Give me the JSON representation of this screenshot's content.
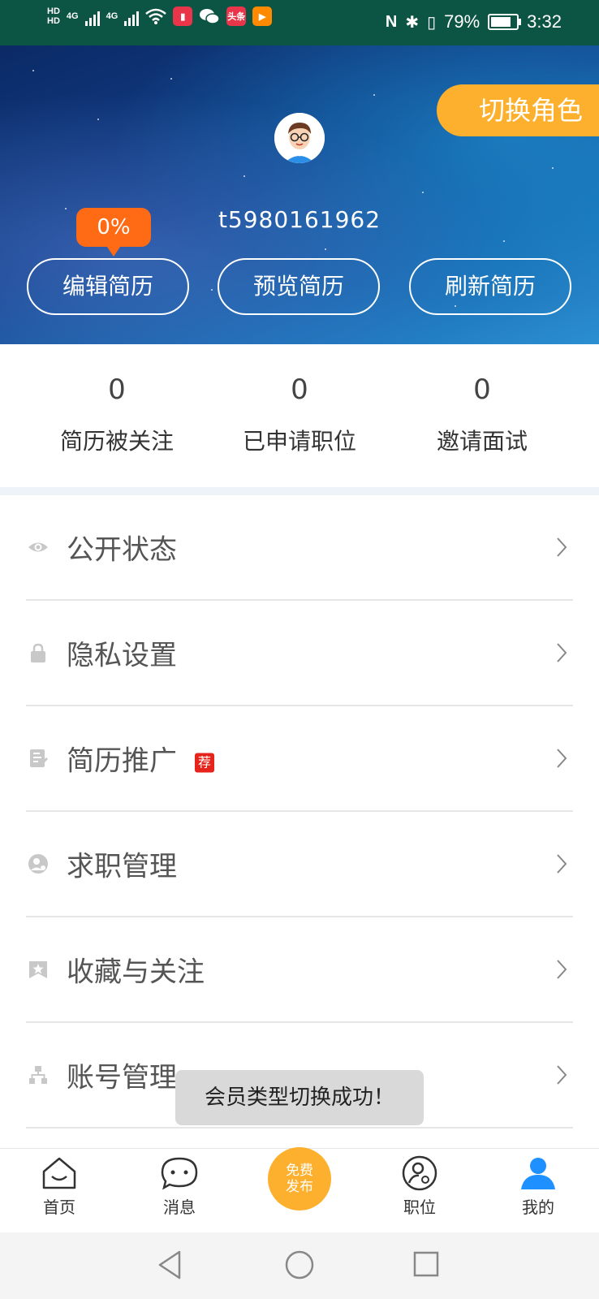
{
  "status_bar": {
    "left_label_1": "HD",
    "left_label_2": "HD",
    "signal_1": "4G",
    "signal_2": "4G",
    "app_toutiao": "头条",
    "battery": "79%",
    "time": "3:32"
  },
  "header": {
    "switch_role": "切换角色",
    "username": "t5980161962",
    "resume_completion": "0%",
    "buttons": [
      "编辑简历",
      "预览简历",
      "刷新简历"
    ]
  },
  "stats": [
    {
      "value": "0",
      "label": "简历被关注"
    },
    {
      "value": "0",
      "label": "已申请职位"
    },
    {
      "value": "0",
      "label": "邀请面试"
    }
  ],
  "menu": [
    {
      "label": "公开状态",
      "icon": "eye-icon"
    },
    {
      "label": "隐私设置",
      "icon": "lock-icon"
    },
    {
      "label": "简历推广",
      "icon": "resume-icon",
      "tag": "荐"
    },
    {
      "label": "求职管理",
      "icon": "manage-icon"
    },
    {
      "label": "收藏与关注",
      "icon": "star-icon"
    },
    {
      "label": "账号管理",
      "icon": "org-icon"
    }
  ],
  "toast": "会员类型切换成功！",
  "tabbar": {
    "home": "首页",
    "messages": "消息",
    "publish_line1": "免费",
    "publish_line2": "发布",
    "jobs": "职位",
    "mine": "我的"
  },
  "colors": {
    "status_bar": "#0c5443",
    "accent_orange": "#fdb02e",
    "completion_badge": "#ff6a15",
    "active_tab": "#1e90ff",
    "tag_red": "#e5241b"
  }
}
